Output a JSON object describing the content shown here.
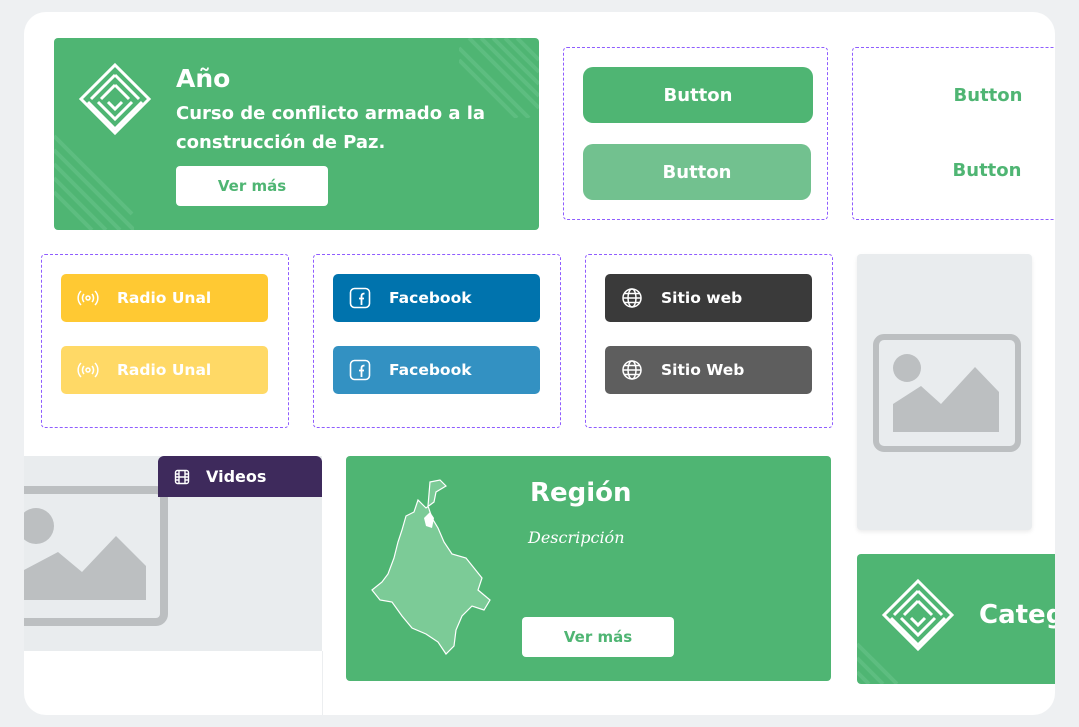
{
  "hero": {
    "title": "Año",
    "subtitle": "Curso de conflicto armado a la construcción de Paz.",
    "button_label": "Ver más"
  },
  "buttons_filled": {
    "primary_label": "Button",
    "secondary_label": "Button"
  },
  "buttons_text": {
    "primary_label": "Button",
    "secondary_label": "Button"
  },
  "social": {
    "radio": {
      "label_1": "Radio Unal",
      "label_2": "Radio Unal",
      "icon": "radio-broadcast-icon"
    },
    "facebook": {
      "label_1": "Facebook",
      "label_2": "Facebook",
      "icon": "facebook-icon"
    },
    "web": {
      "label_1": "Sitio web",
      "label_2": "Sitio Web",
      "icon": "globe-icon"
    }
  },
  "video_card": {
    "tab_label": "Videos",
    "icon": "film-icon"
  },
  "region_card": {
    "title": "Región",
    "description": "Descripción",
    "button_label": "Ver más"
  },
  "category_card": {
    "title": "Catego"
  },
  "colors": {
    "green": "#4fb573",
    "green_light": "#72c18f",
    "yellow": "#ffc933",
    "yellow_light": "#ffd966",
    "facebook_blue": "#0073ad",
    "facebook_blue_light": "#3391c2",
    "dark": "#3a3a3a",
    "dark_light": "#5e5e5e",
    "purple": "#3e2a5c",
    "placeholder_bg": "#e9ecee",
    "placeholder_icon": "#bcbfc1"
  }
}
